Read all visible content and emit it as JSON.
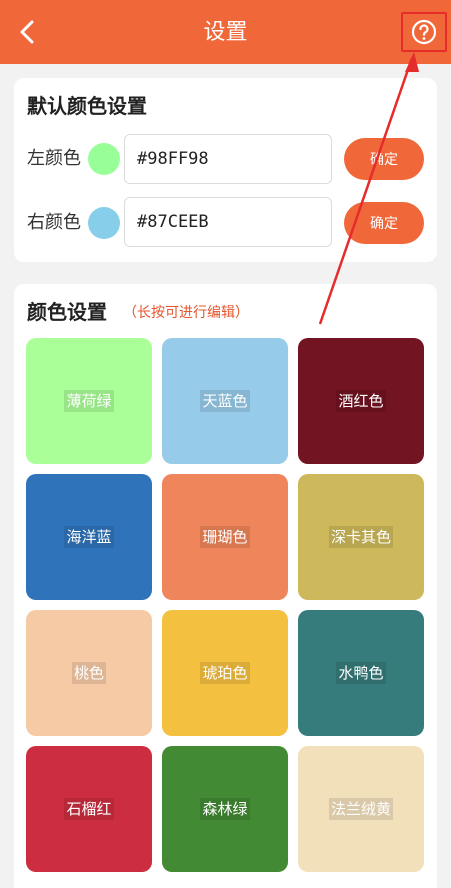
{
  "header": {
    "title": "设置",
    "back_icon": "chevron-left-icon",
    "help_icon": "help-circle-icon"
  },
  "default_colors": {
    "title": "默认颜色设置",
    "left": {
      "label": "左颜色",
      "color": "#98FF98",
      "value": "#98FF98",
      "button": "确定"
    },
    "right": {
      "label": "右颜色",
      "color": "#87CEEB",
      "value": "#87CEEB",
      "button": "确定"
    }
  },
  "color_settings": {
    "title": "颜色设置",
    "hint": "（长按可进行编辑）",
    "tiles": [
      {
        "name": "薄荷绿",
        "color": "#aaff98"
      },
      {
        "name": "天蓝色",
        "color": "#96cbe9"
      },
      {
        "name": "酒红色",
        "color": "#731422"
      },
      {
        "name": "海洋蓝",
        "color": "#2f74ba"
      },
      {
        "name": "珊瑚色",
        "color": "#ef855a"
      },
      {
        "name": "深卡其色",
        "color": "#cdb95b"
      },
      {
        "name": "桃色",
        "color": "#f6caa5"
      },
      {
        "name": "琥珀色",
        "color": "#f4c040"
      },
      {
        "name": "水鸭色",
        "color": "#377c7c"
      },
      {
        "name": "石榴红",
        "color": "#cc2d40"
      },
      {
        "name": "森林绿",
        "color": "#428a33"
      },
      {
        "name": "法兰绒黄",
        "color": "#f2e0bb"
      }
    ]
  },
  "colors": {
    "accent": "#f0673a",
    "annotation": "#e62b2b"
  }
}
